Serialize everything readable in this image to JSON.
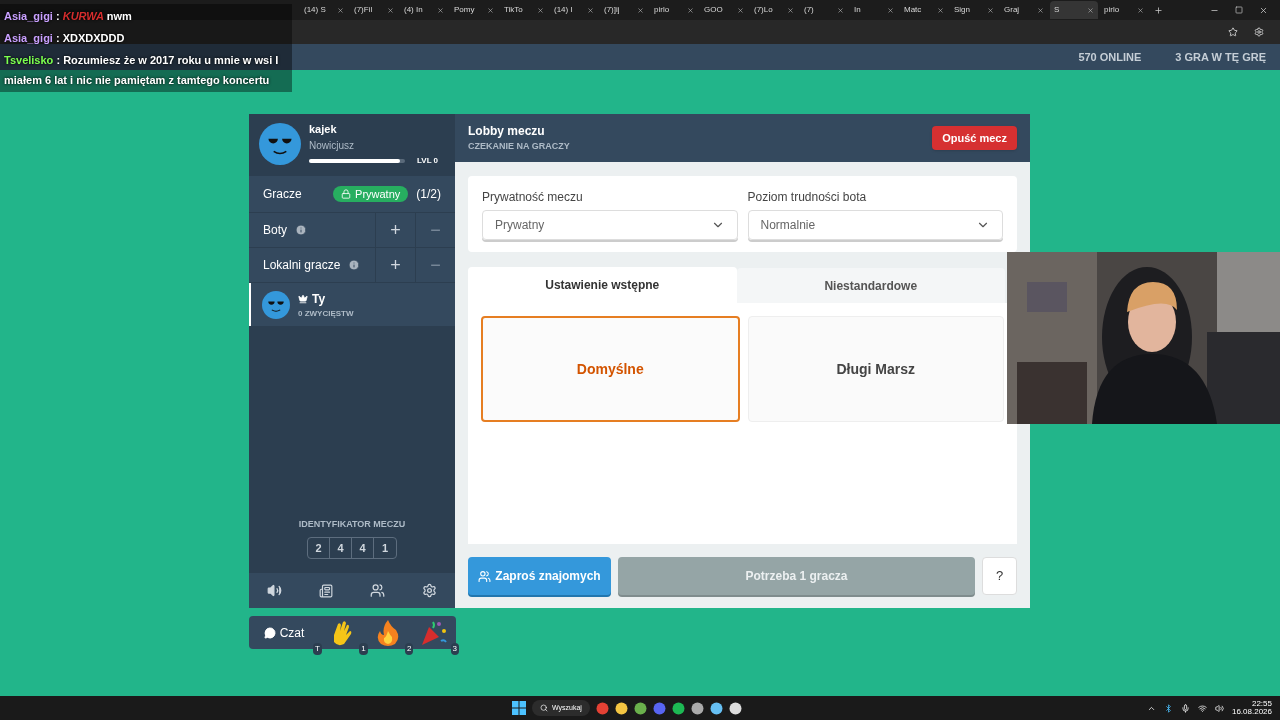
{
  "browser": {
    "tabs": [
      {
        "label": "(14) S",
        "selected": false
      },
      {
        "label": "(7)Fil",
        "selected": false
      },
      {
        "label": "(4) In",
        "selected": false
      },
      {
        "label": "Pomy",
        "selected": false
      },
      {
        "label": "TikTo",
        "selected": false
      },
      {
        "label": "(14) I",
        "selected": false
      },
      {
        "label": "(7)]ij",
        "selected": false
      },
      {
        "label": "pirlo",
        "selected": false
      },
      {
        "label": "GOO",
        "selected": false
      },
      {
        "label": "(7)Lo",
        "selected": false
      },
      {
        "label": "(7)",
        "selected": false
      },
      {
        "label": "In",
        "selected": false
      },
      {
        "label": "Matc",
        "selected": false
      },
      {
        "label": "Sign",
        "selected": false
      },
      {
        "label": "Graj",
        "selected": false
      },
      {
        "label": "S",
        "selected": true
      },
      {
        "label": "pirlo",
        "selected": false
      }
    ]
  },
  "site_header": {
    "online": "570 ONLINE",
    "playing": "3 GRA W TĘ GRĘ"
  },
  "profile": {
    "name": "kajek",
    "rank": "Nowicjusz",
    "level": 0.95,
    "level_label": "LVL 0"
  },
  "players": {
    "label": "Gracze",
    "privacy_badge": "Prywatny",
    "count": "(1/2)"
  },
  "adjust_rows": [
    {
      "label": "Boty",
      "plus": "+",
      "minus": "−",
      "minus_disabled": true
    },
    {
      "label": "Lokalni gracze",
      "plus": "+",
      "minus": "−",
      "minus_disabled": true
    }
  ],
  "player_list": [
    {
      "name": "Ty",
      "wins": "0 ZWYCIĘSTW",
      "host": true
    }
  ],
  "match_id": {
    "label": "IDENTYFIKATOR MECZU",
    "digits": [
      "2",
      "4",
      "4",
      "1"
    ]
  },
  "emote_bar": {
    "chat": "Czat",
    "chat_key": "T",
    "emotes": [
      {
        "kind": "wave",
        "key": "1"
      },
      {
        "kind": "fire",
        "key": "2"
      },
      {
        "kind": "party",
        "key": "3"
      }
    ]
  },
  "lobby": {
    "title": "Lobby meczu",
    "status": "CZEKANIE NA GRACZY",
    "leave": "Opuść mecz"
  },
  "settings": [
    {
      "label": "Prywatność meczu",
      "value": "Prywatny"
    },
    {
      "label": "Poziom trudności bota",
      "value": "Normalnie"
    }
  ],
  "mode_tabs": [
    {
      "label": "Ustawienie wstępne",
      "selected": true
    },
    {
      "label": "Niestandardowe",
      "selected": false
    }
  ],
  "presets": [
    {
      "label": "Domyślne",
      "selected": true
    },
    {
      "label": "Długi Marsz",
      "selected": false
    }
  ],
  "actions": {
    "invite": "Zaproś znajomych",
    "start": "Potrzeba 1 gracza",
    "start_disabled": true,
    "help": "?"
  },
  "chat_overlay": [
    {
      "user": "Asia_gigi",
      "color": "#c9a0ff",
      "sep": ":",
      "emote": "KURWA",
      "text": "nwm"
    },
    {
      "user": "Asia_gigi",
      "color": "#c9a0ff",
      "sep": ":",
      "text": "XDXDXDDD"
    },
    {
      "user": "Tsvelisko",
      "color": "#7cff4f",
      "sep": ":",
      "text": "Rozumiesz że w 2017 roku u mnie w wsi I miałem 6 lat i nic nie pamiętam z tamtego koncertu"
    }
  ],
  "taskbar": {
    "search": "Wyszukaj",
    "time": "22:55",
    "date": "16.08.2026"
  }
}
